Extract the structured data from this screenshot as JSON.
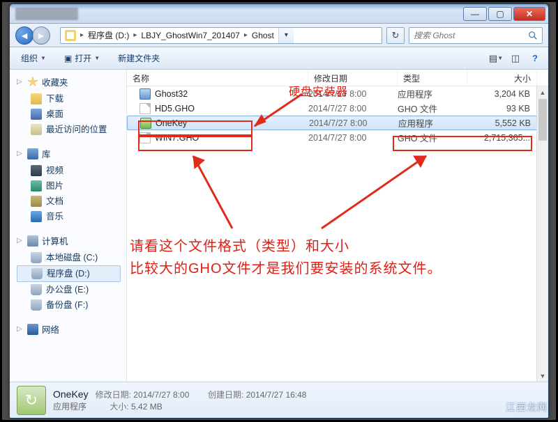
{
  "address": {
    "segments": [
      "程序盘 (D:)",
      "LBJY_GhostWin7_201407",
      "Ghost"
    ]
  },
  "search": {
    "placeholder": "搜索 Ghost"
  },
  "toolbar": {
    "organize": "组织",
    "open": "打开",
    "newfolder": "新建文件夹"
  },
  "columns": {
    "name": "名称",
    "date": "修改日期",
    "type": "类型",
    "size": "大小"
  },
  "files": [
    {
      "name": "Ghost32",
      "date": "2014/7/27 8:00",
      "type": "应用程序",
      "size": "3,204 KB"
    },
    {
      "name": "HD5.GHO",
      "date": "2014/7/27 8:00",
      "type": "GHO 文件",
      "size": "93 KB"
    },
    {
      "name": "OneKey",
      "date": "2014/7/27 8:00",
      "type": "应用程序",
      "size": "5,552 KB"
    },
    {
      "name": "WIN7.GHO",
      "date": "2014/7/27 8:00",
      "type": "GHO 文件",
      "size": "2,715,365..."
    }
  ],
  "sidebar": {
    "fav": {
      "label": "收藏夹",
      "items": [
        "下载",
        "桌面",
        "最近访问的位置"
      ]
    },
    "lib": {
      "label": "库",
      "items": [
        "视频",
        "图片",
        "文档",
        "音乐"
      ]
    },
    "comp": {
      "label": "计算机",
      "items": [
        "本地磁盘 (C:)",
        "程序盘 (D:)",
        "办公盘 (E:)",
        "备份盘 (F:)"
      ]
    },
    "net": {
      "label": "网络"
    }
  },
  "details": {
    "name": "OneKey",
    "type": "应用程序",
    "moddate_label": "修改日期:",
    "moddate": "2014/7/27 8:00",
    "created_label": "创建日期:",
    "created": "2014/7/27 16:48",
    "size_label": "大小:",
    "size": "5.42 MB"
  },
  "annotations": {
    "label1": "硬盘安装器",
    "para_line1": "请看这个文件格式（类型）和大小",
    "para_line2": "比较大的GHO文件才是我们要安装的系统文件。"
  },
  "watermark": "江西龙网"
}
